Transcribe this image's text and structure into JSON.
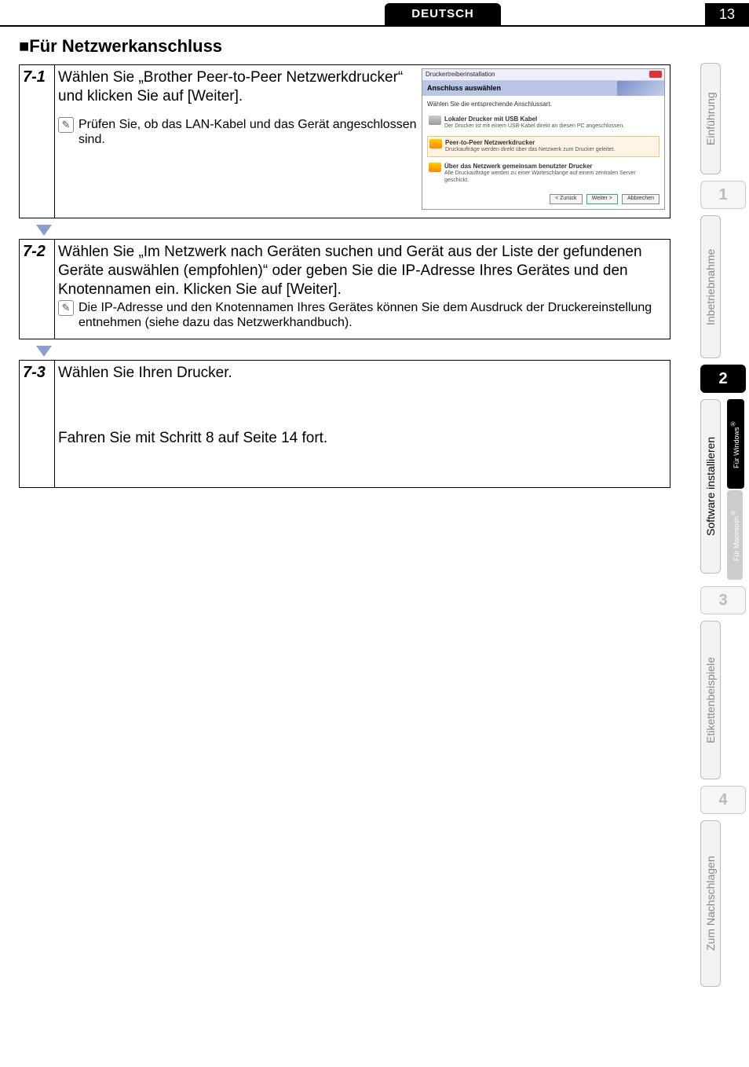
{
  "header": {
    "language": "DEUTSCH",
    "page_number": "13"
  },
  "section_title": "■Für Netzwerkanschluss",
  "steps": {
    "s1": {
      "num": "7-1",
      "text": "Wählen Sie „Brother Peer-to-Peer Netzwerkdrucker“ und klicken Sie auf [Weiter].",
      "note": "Prüfen Sie, ob das LAN-Kabel und das Gerät angeschlossen sind."
    },
    "s2": {
      "num": "7-2",
      "text": "Wählen Sie „Im Netzwerk nach Geräten suchen und Gerät aus der Liste der gefundenen Geräte auswählen (empfohlen)“ oder geben Sie die IP-Adresse Ihres Gerätes und den Knotennamen ein. Klicken Sie auf [Weiter].",
      "note": "Die IP-Adresse und den Knotennamen Ihres Gerätes können Sie dem Ausdruck der Druckereinstellung entnehmen (siehe dazu das Netzwerkhandbuch)."
    },
    "s3": {
      "num": "7-3",
      "text": "Wählen Sie Ihren Drucker.",
      "text2": "Fahren Sie mit Schritt 8 auf Seite 14 fort."
    }
  },
  "screenshot": {
    "window_title": "Druckertreiberinstallation",
    "heading": "Anschluss auswählen",
    "instruction": "Wählen Sie die entsprechende Anschlussart.",
    "opt1_title": "Lokaler Drucker mit USB Kabel",
    "opt1_desc": "Der Drucker ist mit einem USB-Kabel direkt an diesen PC angeschlossen.",
    "opt2_title": "Peer-to-Peer Netzwerkdrucker",
    "opt2_desc": "Druckaufträge werden direkt über das Netzwerk zum Drucker geleitet.",
    "opt3_title": "Über das Netzwerk gemeinsam benutzter Drucker",
    "opt3_desc": "Alle Druckaufträge werden zu einer Warteschlange auf einem zentralen Server geschickt.",
    "btn_back": "< Zurück",
    "btn_next": "Weiter >",
    "btn_cancel": "Abbrechen"
  },
  "tabs": {
    "t0": "Einführung",
    "n1": "1",
    "t1": "Inbetriebnahme",
    "n2": "2",
    "t2": "Software installieren",
    "t2_win": "Für Windows",
    "t2_mac": "Für Macintosh",
    "n3": "3",
    "t3": "Etikettenbeispiele",
    "n4": "4",
    "t4": "Zum Nachschlagen"
  }
}
